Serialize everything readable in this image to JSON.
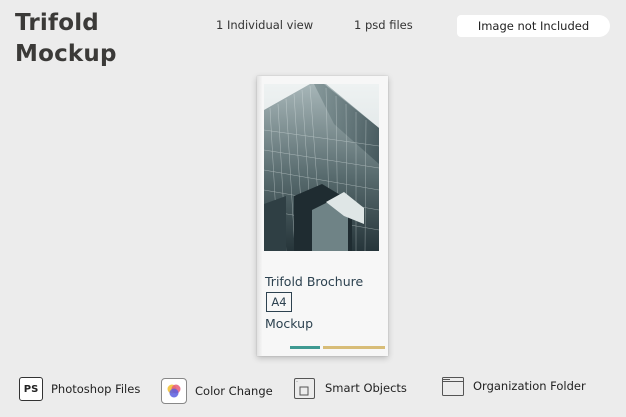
{
  "header": {
    "title_line1": "Trifold",
    "title_line2": "Mockup",
    "view_count": "1 Individual view",
    "file_count": "1 psd files",
    "badge": "Image not Included"
  },
  "brochure": {
    "title": "Trifold Brochure",
    "size": "A4",
    "subtitle": "Mockup",
    "accent_colors": [
      "#3f9a92",
      "#d8bd78"
    ]
  },
  "features": [
    {
      "icon": "photoshop-icon",
      "icon_text": "PS",
      "label": "Photoshop Files"
    },
    {
      "icon": "color-change-icon",
      "label": "Color Change"
    },
    {
      "icon": "smart-objects-icon",
      "label": "Smart Objects"
    },
    {
      "icon": "folder-icon",
      "label": "Organization Folder"
    }
  ]
}
